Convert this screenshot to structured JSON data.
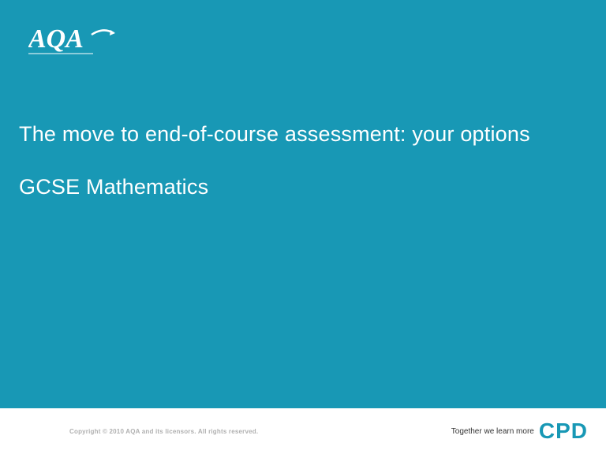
{
  "logo": {
    "name": "AQA"
  },
  "title": "The move to end-of-course assessment: your options",
  "subtitle": "GCSE Mathematics",
  "footer": {
    "copyright": "Copyright © 2010 AQA and its licensors. All rights reserved.",
    "tagline": "Together we learn more",
    "brand": "CPD"
  },
  "colors": {
    "primary": "#1898b5",
    "text_light": "#ffffff",
    "text_muted": "#b0b0b0"
  }
}
